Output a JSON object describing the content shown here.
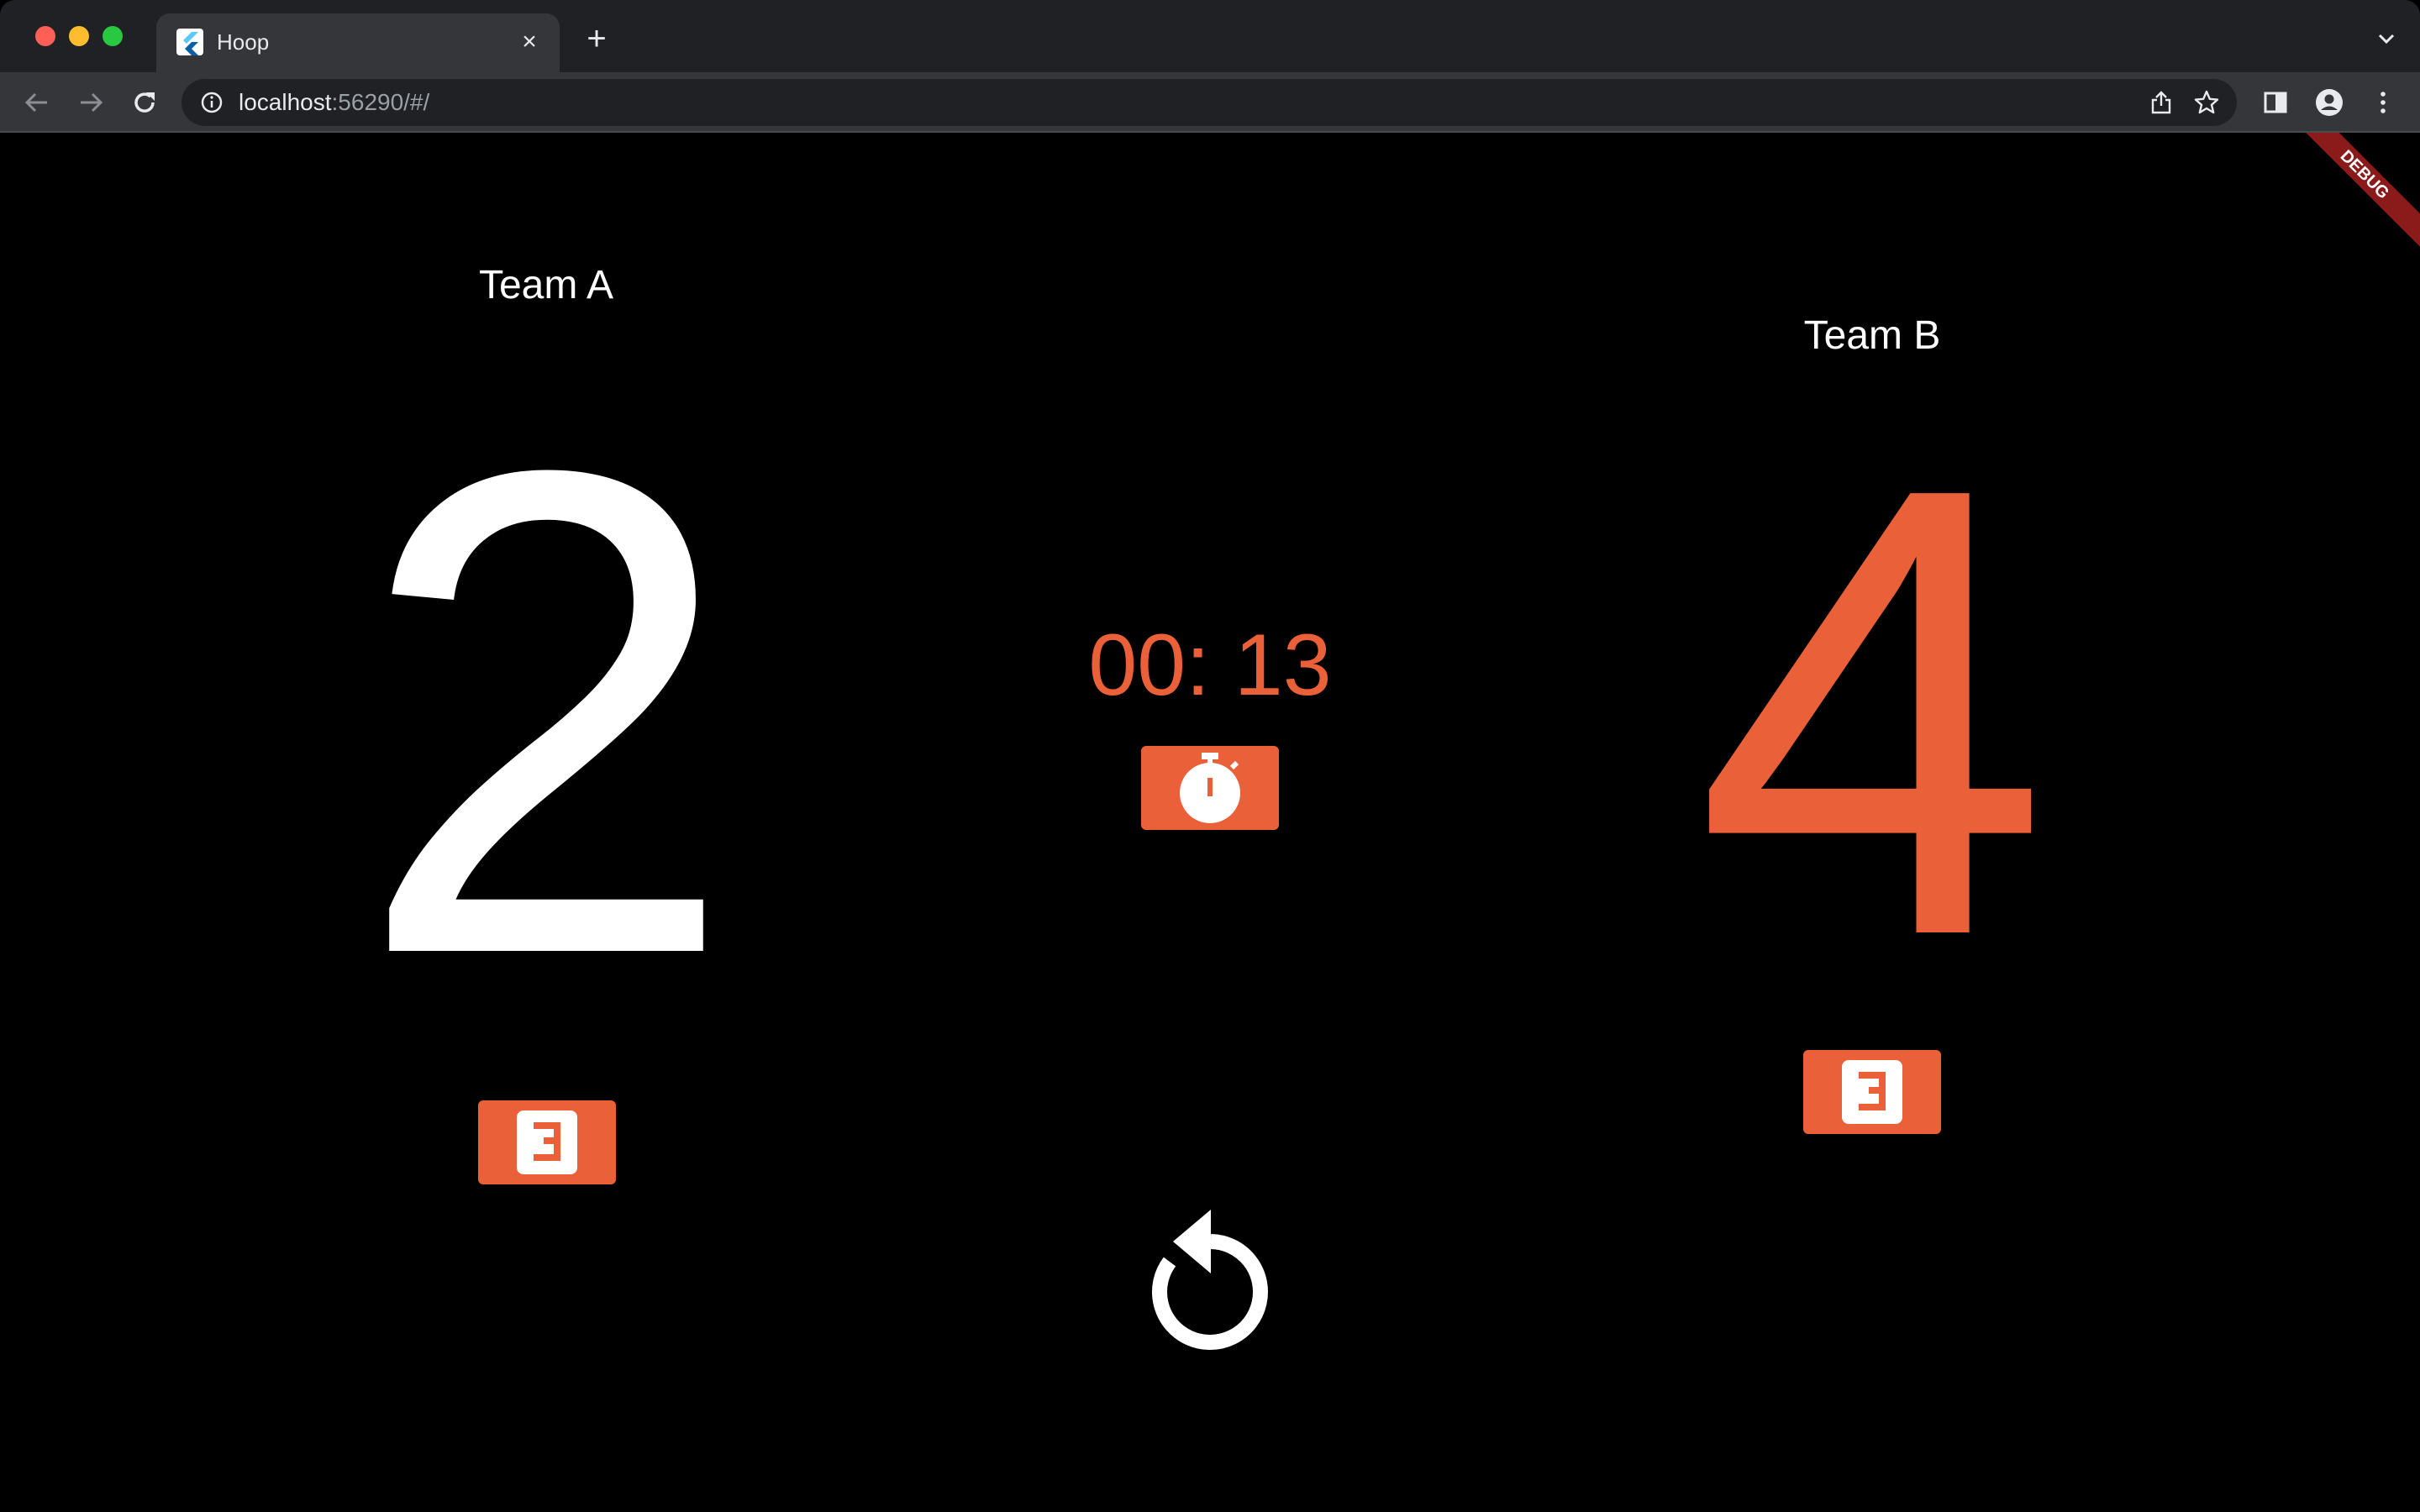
{
  "browser": {
    "tab_title": "Hoop",
    "tab_close": "×",
    "new_tab": "+",
    "url_host": "localhost",
    "url_rest": ":56290/#/"
  },
  "app": {
    "debug_banner": "DEBUG",
    "team_a": {
      "name": "Team A",
      "score": "2",
      "score_color": "#ffffff"
    },
    "team_b": {
      "name": "Team B",
      "score": "4",
      "score_color": "#ea6139"
    },
    "timer": "00: 13",
    "accent_color": "#ea6139",
    "icons": {
      "team_a_action": "three-point-icon",
      "team_b_action": "three-point-icon",
      "timer_action": "stopwatch-icon",
      "reset": "reset-icon"
    }
  }
}
